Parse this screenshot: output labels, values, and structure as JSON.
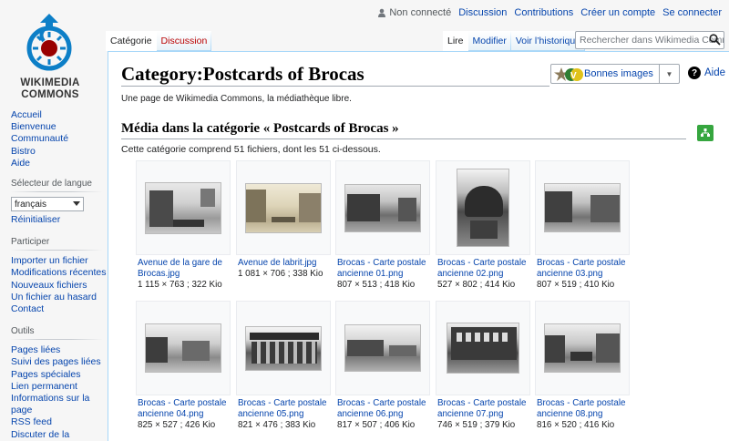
{
  "logo": {
    "line1": "WIKIMEDIA",
    "line2": "COMMONS"
  },
  "personal": {
    "not_logged": "Non connecté",
    "discussion": "Discussion",
    "contributions": "Contributions",
    "create_account": "Créer un compte",
    "login": "Se connecter"
  },
  "navigation": {
    "items": [
      {
        "label": "Accueil"
      },
      {
        "label": "Bienvenue"
      },
      {
        "label": "Communauté"
      },
      {
        "label": "Bistro"
      },
      {
        "label": "Aide"
      }
    ]
  },
  "language": {
    "heading": "Sélecteur de langue",
    "selected": "français",
    "reset": "Réinitialiser"
  },
  "participate": {
    "heading": "Participer",
    "items": [
      {
        "label": "Importer un fichier"
      },
      {
        "label": "Modifications récentes"
      },
      {
        "label": "Nouveaux fichiers"
      },
      {
        "label": "Un fichier au hasard"
      },
      {
        "label": "Contact"
      }
    ]
  },
  "tools": {
    "heading": "Outils",
    "items": [
      {
        "label": "Pages liées"
      },
      {
        "label": "Suivi des pages liées"
      },
      {
        "label": "Pages spéciales"
      },
      {
        "label": "Lien permanent"
      },
      {
        "label": "Informations sur la page"
      },
      {
        "label": "RSS feed"
      },
      {
        "label": "Discuter de la catégorie"
      }
    ]
  },
  "tabs": {
    "category": "Catégorie",
    "discussion": "Discussion",
    "read": "Lire",
    "edit": "Modifier",
    "history": "Voir l’historique"
  },
  "search": {
    "placeholder": "Rechercher dans Wikimedia Commons"
  },
  "page": {
    "title": "Category:Postcards of Brocas",
    "quality_images": "Bonnes images",
    "help": "Aide",
    "tagline": "Une page de Wikimedia Commons, la médiathèque libre.",
    "section_heading": "Média dans la catégorie « Postcards of Brocas »",
    "count_text": "Cette catégorie comprend 51 fichiers, dont les 51 ci-dessous."
  },
  "gallery": [
    {
      "name": "Avenue de la gare de Brocas.jpg",
      "meta": "1 115 × 763 ; 322 Kio"
    },
    {
      "name": "Avenue de labrit.jpg",
      "meta": "1 081 × 706 ; 338 Kio"
    },
    {
      "name": "Brocas - Carte postale ancienne 01.png",
      "meta": "807 × 513 ; 418 Kio"
    },
    {
      "name": "Brocas - Carte postale ancienne 02.png",
      "meta": "527 × 802 ; 414 Kio"
    },
    {
      "name": "Brocas - Carte postale ancienne 03.png",
      "meta": "807 × 519 ; 410 Kio"
    },
    {
      "name": "Brocas - Carte postale ancienne 04.png",
      "meta": "825 × 527 ; 426 Kio"
    },
    {
      "name": "Brocas - Carte postale ancienne 05.png",
      "meta": "821 × 476 ; 383 Kio"
    },
    {
      "name": "Brocas - Carte postale ancienne 06.png",
      "meta": "817 × 507 ; 406 Kio"
    },
    {
      "name": "Brocas - Carte postale ancienne 07.png",
      "meta": "746 × 519 ; 379 Kio"
    },
    {
      "name": "Brocas - Carte postale ancienne 08.png",
      "meta": "816 × 520 ; 416 Kio"
    }
  ],
  "colors": {
    "link": "#0645ad",
    "new_link": "#ba0000",
    "accent_green": "#36a63f",
    "logo_blue": "#0d7fc7",
    "logo_red": "#990000"
  }
}
